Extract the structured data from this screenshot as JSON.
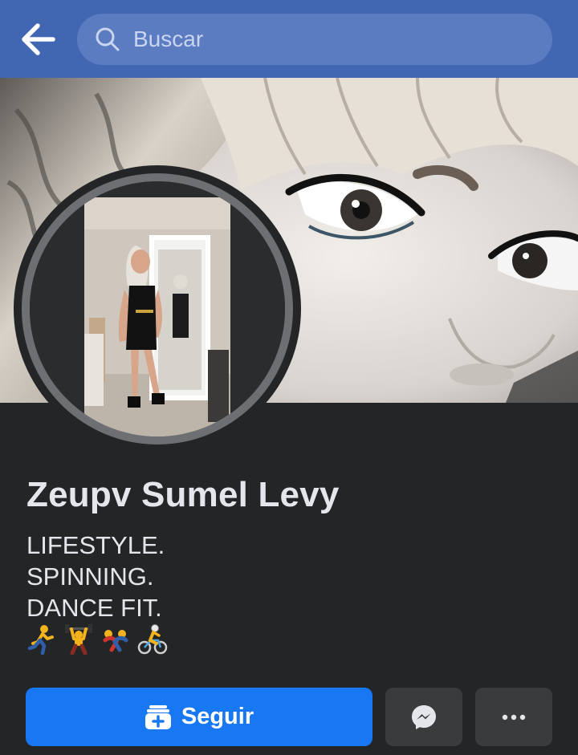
{
  "header": {
    "back_icon": "arrow-left-icon",
    "search_placeholder": "Buscar",
    "search_icon": "search-icon",
    "bar_color": "#4267b2"
  },
  "profile": {
    "name": "Zeupv Sumel Levy",
    "bio_lines": [
      "LIFESTYLE.",
      "SPINNING.",
      "DANCE FIT."
    ],
    "emoji_icons": [
      "person-running-icon",
      "person-lifting-weights-icon",
      "people-wrestling-icon",
      "person-biking-icon"
    ]
  },
  "actions": {
    "follow_label": "Seguir",
    "follow_icon": "add-friend-icon",
    "message_icon": "messenger-icon",
    "more_icon": "more-dots-icon",
    "accent_color": "#1877f2"
  }
}
